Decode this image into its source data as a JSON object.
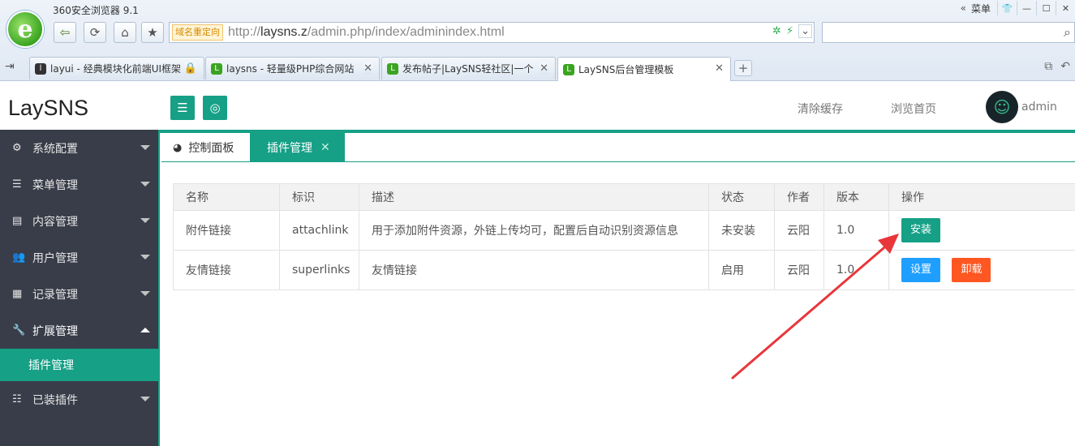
{
  "browser": {
    "title": "360安全浏览器 9.1",
    "menu_label": "菜单",
    "address_tag": "域名重定向",
    "url_prefix": "http://",
    "url_host": "laysns.z",
    "url_path": "/admin.php/index/adminindex.html",
    "tabs": [
      {
        "label": "layui - 经典模块化前端UI框架"
      },
      {
        "label": "laysns - 轻量级PHP综合网站"
      },
      {
        "label": "发布帖子|LaySNS轻社区|一个"
      },
      {
        "label": "LaySNS后台管理模板"
      }
    ]
  },
  "header": {
    "logo": "LaySNS",
    "clear_cache": "清除缓存",
    "browse_home": "浏览首页",
    "username": "admin"
  },
  "sidebar": {
    "items": [
      {
        "label": "系统配置",
        "icon": "gears-icon"
      },
      {
        "label": "菜单管理",
        "icon": "list-icon"
      },
      {
        "label": "内容管理",
        "icon": "file-icon"
      },
      {
        "label": "用户管理",
        "icon": "users-icon"
      },
      {
        "label": "记录管理",
        "icon": "grid-icon"
      },
      {
        "label": "扩展管理",
        "icon": "wrench-icon"
      },
      {
        "label": "已装插件",
        "icon": "sliders-icon"
      }
    ],
    "sub_item": "插件管理"
  },
  "page_tabs": [
    {
      "label": "控制面板"
    },
    {
      "label": "插件管理"
    }
  ],
  "table": {
    "headers": [
      "名称",
      "标识",
      "描述",
      "状态",
      "作者",
      "版本",
      "操作"
    ],
    "rows": [
      {
        "name": "附件链接",
        "id": "attachlink",
        "desc": "用于添加附件资源，外链上传均可，配置后自动识别资源信息",
        "status": "未安装",
        "author": "云阳",
        "version": "1.0"
      },
      {
        "name": "友情链接",
        "id": "superlinks",
        "desc": "友情链接",
        "status": "启用",
        "author": "云阳",
        "version": "1.0"
      }
    ],
    "actions": {
      "install": "安装",
      "setting": "设置",
      "uninstall": "卸载"
    }
  },
  "colors": {
    "accent": "#16a086",
    "sidebar": "#393d49",
    "setting": "#1e9fff",
    "uninstall": "#ff5722",
    "annotation": "#e8363b"
  }
}
